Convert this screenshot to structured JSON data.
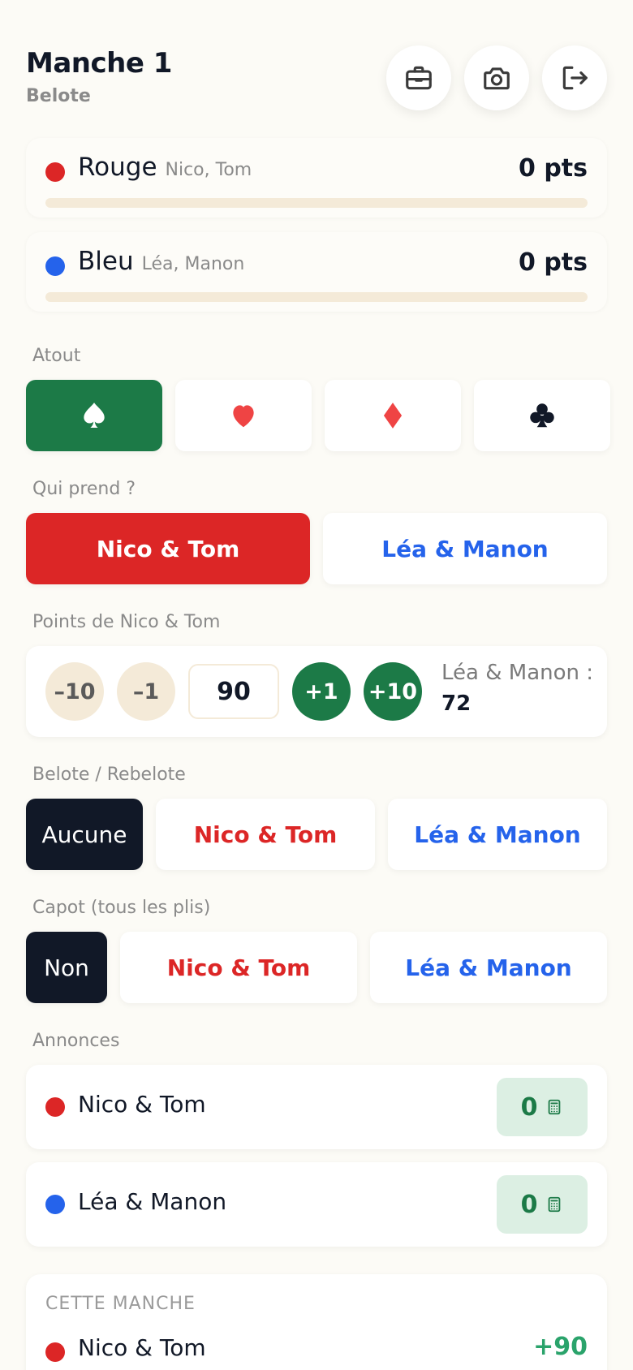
{
  "header": {
    "title": "Manche 1",
    "subtitle": "Belote",
    "icons": [
      "briefcase-icon",
      "camera-icon",
      "logout-icon"
    ]
  },
  "teams": [
    {
      "name": "Rouge",
      "players": "Nico, Tom",
      "points": "0 pts",
      "color": "#dc2626",
      "progress": 0
    },
    {
      "name": "Bleu",
      "players": "Léa, Manon",
      "points": "0 pts",
      "color": "#2563eb",
      "progress": 0
    }
  ],
  "atout": {
    "label": "Atout",
    "suits": [
      "spade-icon",
      "heart-icon",
      "diamond-icon",
      "club-icon"
    ],
    "selected": "spade-icon"
  },
  "taker": {
    "label": "Qui prend ?",
    "options": [
      "Nico & Tom",
      "Léa & Manon"
    ],
    "selected": "Nico & Tom"
  },
  "points": {
    "label": "Points de Nico & Tom",
    "minus10": "–10",
    "minus1": "–1",
    "value": "90",
    "plus1": "+1",
    "plus10": "+10",
    "other_label": "Léa & Manon :",
    "other_value": "72"
  },
  "belote": {
    "label": "Belote / Rebelote",
    "options": [
      "Aucune",
      "Nico & Tom",
      "Léa & Manon"
    ],
    "selected": "Aucune"
  },
  "capot": {
    "label": "Capot (tous les plis)",
    "options": [
      "Non",
      "Nico & Tom",
      "Léa & Manon"
    ],
    "selected": "Non"
  },
  "annonces": {
    "label": "Annonces",
    "rows": [
      {
        "team": "Nico & Tom",
        "value": "0",
        "color": "#dc2626"
      },
      {
        "team": "Léa & Manon",
        "value": "0",
        "color": "#2563eb"
      }
    ]
  },
  "summary": {
    "title": "CETTE MANCHE",
    "rows": [
      {
        "team": "Nico & Tom",
        "score": "+90",
        "color": "#dc2626"
      }
    ]
  },
  "colors": {
    "accent_green": "#1c7a47",
    "red": "#dc2626",
    "blue": "#2563eb",
    "dark": "#111827",
    "background": "#fcfbf6"
  }
}
